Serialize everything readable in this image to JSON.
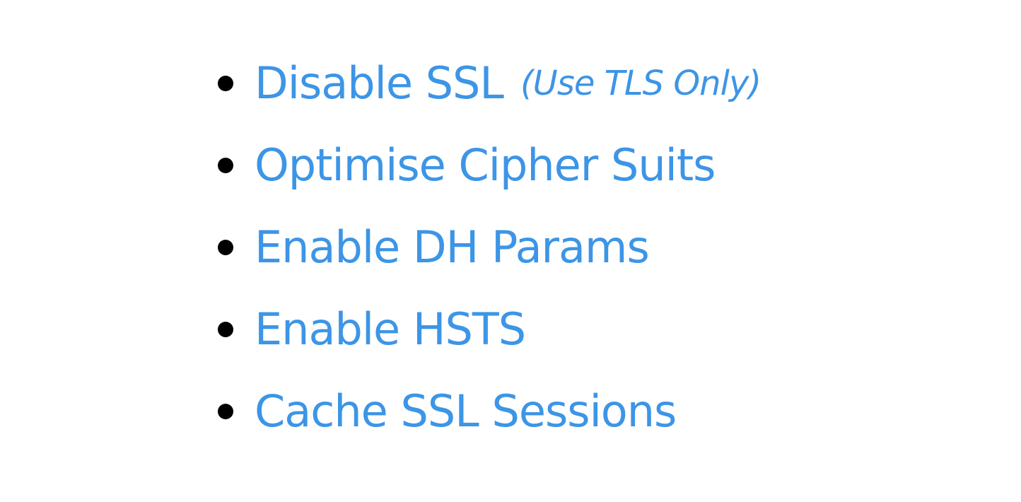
{
  "slide": {
    "items": [
      {
        "text": "Disable SSL",
        "note": "(Use TLS Only)"
      },
      {
        "text": "Optimise Cipher Suits"
      },
      {
        "text": "Enable DH Params"
      },
      {
        "text": "Enable HSTS"
      },
      {
        "text": "Cache SSL Sessions"
      }
    ]
  },
  "colors": {
    "text": "#3d95e6",
    "bullet": "#000000",
    "background": "#ffffff"
  }
}
